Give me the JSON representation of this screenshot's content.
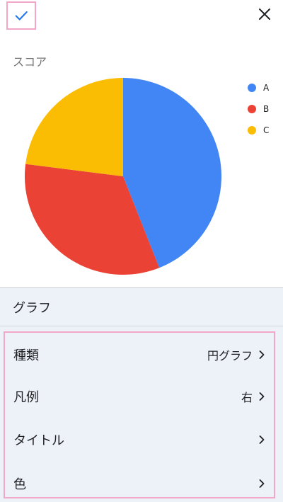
{
  "toolbar": {
    "confirm_icon": "check-icon",
    "close_icon": "close-icon"
  },
  "chart_data": {
    "type": "pie",
    "title": "スコア",
    "categories": [
      "A",
      "B",
      "C"
    ],
    "values": [
      44,
      33,
      23
    ],
    "colors": [
      "#4285f4",
      "#ea4335",
      "#fbbc04"
    ],
    "legend_position": "right"
  },
  "panel": {
    "section_title": "グラフ",
    "options": [
      {
        "label": "種類",
        "value": "円グラフ"
      },
      {
        "label": "凡例",
        "value": "右"
      },
      {
        "label": "タイトル",
        "value": ""
      },
      {
        "label": "色",
        "value": ""
      }
    ]
  }
}
